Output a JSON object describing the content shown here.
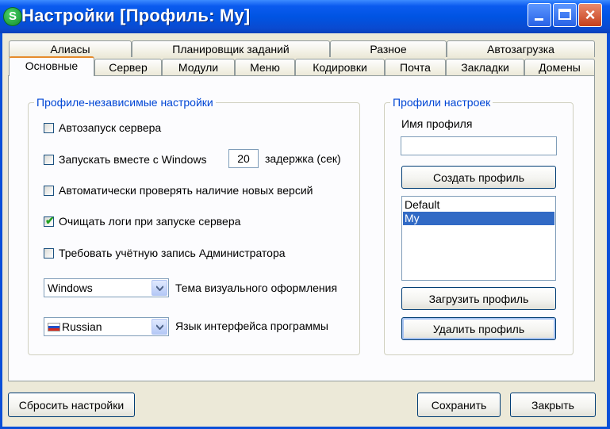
{
  "window": {
    "title": "Настройки [Профиль: My]",
    "app_icon_letter": "S",
    "controls": {
      "minimize": "minimize-icon",
      "maximize": "maximize-icon",
      "close": "×"
    },
    "accent": "#0054e3"
  },
  "tabs": {
    "row1": [
      "Алиасы",
      "Планировщик заданий",
      "Разное",
      "Автозагрузка"
    ],
    "row2": [
      "Основные",
      "Сервер",
      "Модули",
      "Меню",
      "Кодировки",
      "Почта",
      "Закладки",
      "Домены"
    ],
    "active": "Основные"
  },
  "independent": {
    "legend": "Профиле-независимые настройки",
    "autostart_label": "Автозапуск сервера",
    "autostart_checked": false,
    "with_windows_label": "Запускать вместе с Windows",
    "with_windows_checked": false,
    "delay_value": "20",
    "delay_label": "задержка (сек)",
    "check_updates_label": "Автоматически проверять наличие новых версий",
    "check_updates_checked": false,
    "clear_logs_label": "Очищать логи при запуске сервера",
    "clear_logs_checked": true,
    "clear_logs_mark": "✔",
    "require_admin_label": "Требовать учётную запись Администратора",
    "require_admin_checked": false,
    "theme_value": "Windows",
    "theme_label": "Тема визуального оформления",
    "language_value": "Russian",
    "language_label": "Язык интерфейса программы"
  },
  "profiles": {
    "legend": "Профили настроек",
    "name_label": "Имя профиля",
    "name_value": "",
    "create_button": "Создать профиль",
    "items": [
      "Default",
      "My"
    ],
    "selected": "My",
    "load_button": "Загрузить профиль",
    "delete_button": "Удалить профиль"
  },
  "footer": {
    "reset_button": "Сбросить настройки",
    "save_button": "Сохранить",
    "close_button": "Закрыть"
  }
}
